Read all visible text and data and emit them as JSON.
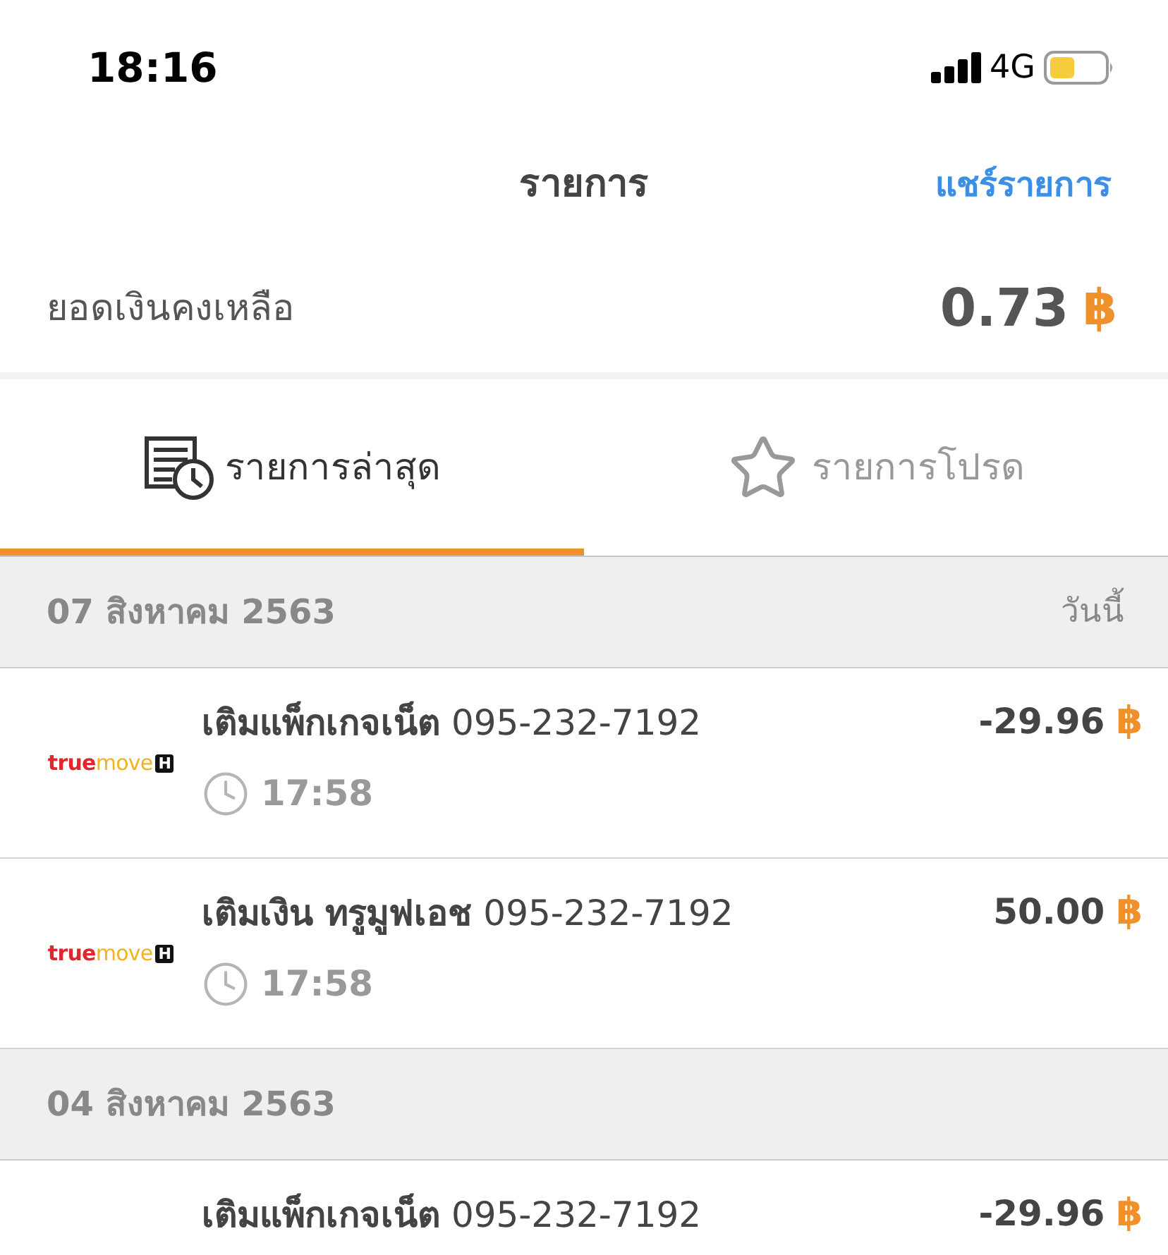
{
  "status_bar": {
    "time": "18:16",
    "network": "4G"
  },
  "nav_bar": {
    "title": "รายการ",
    "action": "แชร์รายการ"
  },
  "balance": {
    "label": "ยอดเงินคงเหลือ",
    "amount": "0.73",
    "currency": "฿"
  },
  "tabs": [
    {
      "kind": "recent",
      "label": "รายการล่าสุด",
      "selected": true
    },
    {
      "kind": "favorites",
      "label": "รายการโปรด",
      "selected": false
    }
  ],
  "sections": [
    {
      "date": "07 สิงหาคม 2563",
      "note": "วันนี้",
      "transactions": [
        {
          "logo": [
            "true",
            "move",
            "H"
          ],
          "title": "**เติมแพ็กเกจเน็ต** 095-232-7192",
          "time": "17:58",
          "amount": "-29.96",
          "currency": "฿"
        },
        {
          "logo": [
            "true",
            "move",
            "H"
          ],
          "title": "**เติมเงิน ทรูมูฟเอช** 095-232-7192",
          "time": "17:58",
          "amount": "50.00",
          "currency": "฿"
        }
      ]
    },
    {
      "date": "04 สิงหาคม 2563",
      "transactions": [
        {
          "title": "**เติมแพ็กเกจเน็ต** 095-232-7192",
          "amount": "-29.96",
          "currency": "฿"
        }
      ]
    }
  ]
}
